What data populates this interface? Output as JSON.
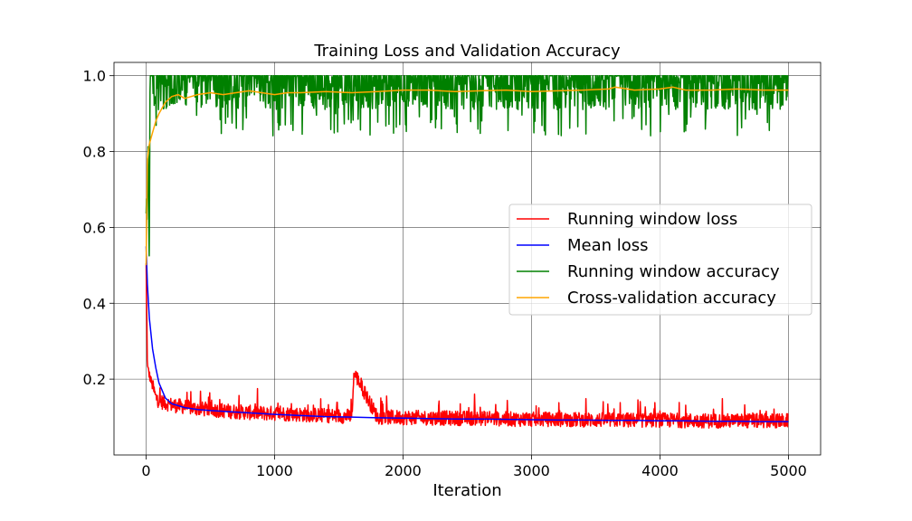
{
  "chart_data": {
    "type": "line",
    "title": "Training Loss and Validation Accuracy",
    "xlabel": "Iteration",
    "ylabel": "",
    "xlim": [
      -250,
      5250
    ],
    "ylim": [
      0.0,
      1.035
    ],
    "xticks": [
      0,
      1000,
      2000,
      3000,
      4000,
      5000
    ],
    "yticks": [
      0.2,
      0.4,
      0.6,
      0.8,
      1.0
    ],
    "xtick_labels": [
      "0",
      "1000",
      "2000",
      "3000",
      "4000",
      "5000"
    ],
    "ytick_labels": [
      "0.2",
      "0.4",
      "0.6",
      "0.8",
      "1.0"
    ],
    "grid": true,
    "legend_position": "center-right",
    "series": [
      {
        "name": "Running window loss",
        "color": "#ff0000",
        "x": [
          0,
          10,
          25,
          50,
          75,
          100,
          150,
          200,
          300,
          400,
          500,
          700,
          900,
          1000,
          1200,
          1400,
          1600,
          1620,
          1800,
          2000,
          2200,
          2400,
          2600,
          2800,
          3000,
          3200,
          3400,
          3600,
          3800,
          4000,
          4200,
          4400,
          4600,
          4800,
          5000
        ],
        "y": [
          0.5,
          0.23,
          0.21,
          0.18,
          0.15,
          0.14,
          0.135,
          0.13,
          0.125,
          0.12,
          0.118,
          0.112,
          0.108,
          0.108,
          0.105,
          0.102,
          0.1,
          0.215,
          0.098,
          0.097,
          0.096,
          0.095,
          0.095,
          0.093,
          0.092,
          0.092,
          0.091,
          0.09,
          0.09,
          0.09,
          0.089,
          0.088,
          0.088,
          0.088,
          0.088
        ]
      },
      {
        "name": "Mean loss",
        "color": "#0000ff",
        "x": [
          0,
          10,
          25,
          50,
          75,
          100,
          150,
          200,
          300,
          400,
          500,
          700,
          900,
          1000,
          1200,
          1400,
          1600,
          1800,
          2000,
          2200,
          2400,
          2600,
          2800,
          3000,
          3200,
          3400,
          3600,
          3800,
          4000,
          4200,
          4400,
          4600,
          4800,
          5000
        ],
        "y": [
          0.55,
          0.45,
          0.36,
          0.28,
          0.23,
          0.19,
          0.15,
          0.135,
          0.125,
          0.12,
          0.117,
          0.113,
          0.109,
          0.107,
          0.104,
          0.101,
          0.1,
          0.098,
          0.097,
          0.096,
          0.095,
          0.095,
          0.094,
          0.093,
          0.092,
          0.092,
          0.091,
          0.091,
          0.09,
          0.09,
          0.089,
          0.089,
          0.088,
          0.088
        ]
      },
      {
        "name": "Running window accuracy",
        "color": "#008000",
        "x": [
          0,
          10,
          25,
          50,
          75,
          100,
          150,
          200,
          250,
          300,
          400,
          500,
          700,
          900,
          1000,
          1200,
          1400,
          1600,
          1800,
          2000,
          2200,
          2400,
          2600,
          2800,
          3000,
          3200,
          3400,
          3600,
          3800,
          4000,
          4200,
          4400,
          4600,
          4800,
          5000
        ],
        "y": [
          0.62,
          0.77,
          0.6,
          0.88,
          0.86,
          0.9,
          0.92,
          0.78,
          0.92,
          0.93,
          0.93,
          0.94,
          0.94,
          0.94,
          0.94,
          0.94,
          0.95,
          0.94,
          0.95,
          0.95,
          0.95,
          0.95,
          0.95,
          0.95,
          0.95,
          0.95,
          0.95,
          0.95,
          0.95,
          0.96,
          0.96,
          0.96,
          0.96,
          0.96,
          0.95
        ]
      },
      {
        "name": "Cross-validation accuracy",
        "color": "#ffa500",
        "x": [
          0,
          10,
          25,
          50,
          75,
          100,
          150,
          200,
          250,
          300,
          400,
          500,
          600,
          700,
          800,
          900,
          1000,
          1100,
          1200,
          1400,
          1600,
          1800,
          2000,
          2200,
          2400,
          2600,
          2800,
          3000,
          3200,
          3400,
          3600,
          3650,
          3800,
          4000,
          4100,
          4200,
          4400,
          4600,
          4800,
          5000
        ],
        "y": [
          0.5,
          0.78,
          0.82,
          0.85,
          0.88,
          0.9,
          0.93,
          0.945,
          0.95,
          0.94,
          0.95,
          0.955,
          0.95,
          0.955,
          0.96,
          0.955,
          0.95,
          0.955,
          0.955,
          0.958,
          0.955,
          0.958,
          0.962,
          0.962,
          0.958,
          0.96,
          0.962,
          0.958,
          0.96,
          0.962,
          0.965,
          0.97,
          0.962,
          0.965,
          0.97,
          0.962,
          0.962,
          0.965,
          0.962,
          0.962
        ]
      }
    ]
  }
}
